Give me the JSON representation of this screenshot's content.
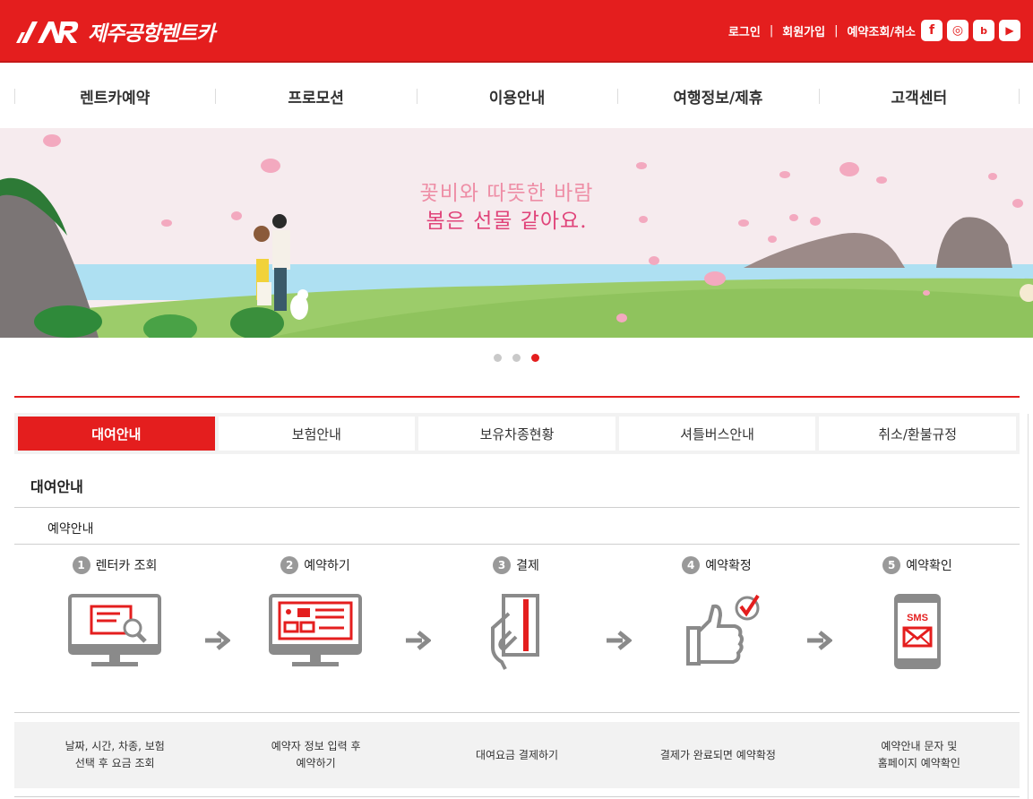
{
  "header": {
    "logo_mark": "JJAR",
    "logo_text": "제주공항렌트카",
    "links": {
      "login": "로그인",
      "signup": "회원가입",
      "reservation": "예약조회/취소"
    },
    "sns": [
      {
        "name": "facebook-icon",
        "glyph": "f"
      },
      {
        "name": "instagram-icon",
        "glyph": "◎"
      },
      {
        "name": "blog-icon",
        "glyph": "b"
      },
      {
        "name": "youtube-icon",
        "glyph": "▶"
      }
    ]
  },
  "gnb": [
    "렌트카예약",
    "프로모션",
    "이용안내",
    "여행정보/제휴",
    "고객센터"
  ],
  "banner": {
    "line1": "꽃비와 따뜻한 바람",
    "line2": "봄은 선물 같아요.",
    "slide_count": 3,
    "active_slide": 3
  },
  "tabs": [
    {
      "label": "대여안내",
      "active": true
    },
    {
      "label": "보험안내",
      "active": false
    },
    {
      "label": "보유차종현황",
      "active": false
    },
    {
      "label": "셔틀버스안내",
      "active": false
    },
    {
      "label": "취소/환불규정",
      "active": false
    }
  ],
  "section_title": "대여안내",
  "sub_title": "예약안내",
  "steps": [
    {
      "num": "1",
      "label": "렌터카 조회",
      "desc": "날짜, 시간, 차종, 보험\n선택 후 요금 조회"
    },
    {
      "num": "2",
      "label": "예약하기",
      "desc": "예약자 정보 입력 후\n예약하기"
    },
    {
      "num": "3",
      "label": "결제",
      "desc": "대여요금 결제하기"
    },
    {
      "num": "4",
      "label": "예약확정",
      "desc": "결제가 완료되면 예약확정"
    },
    {
      "num": "5",
      "label": "예약확인",
      "desc": "예약안내 문자 및\n홈페이지 예약확인"
    }
  ],
  "sms_label": "SMS",
  "colors": {
    "brand": "#e41e1e",
    "icon_gray": "#8a8a8a"
  }
}
